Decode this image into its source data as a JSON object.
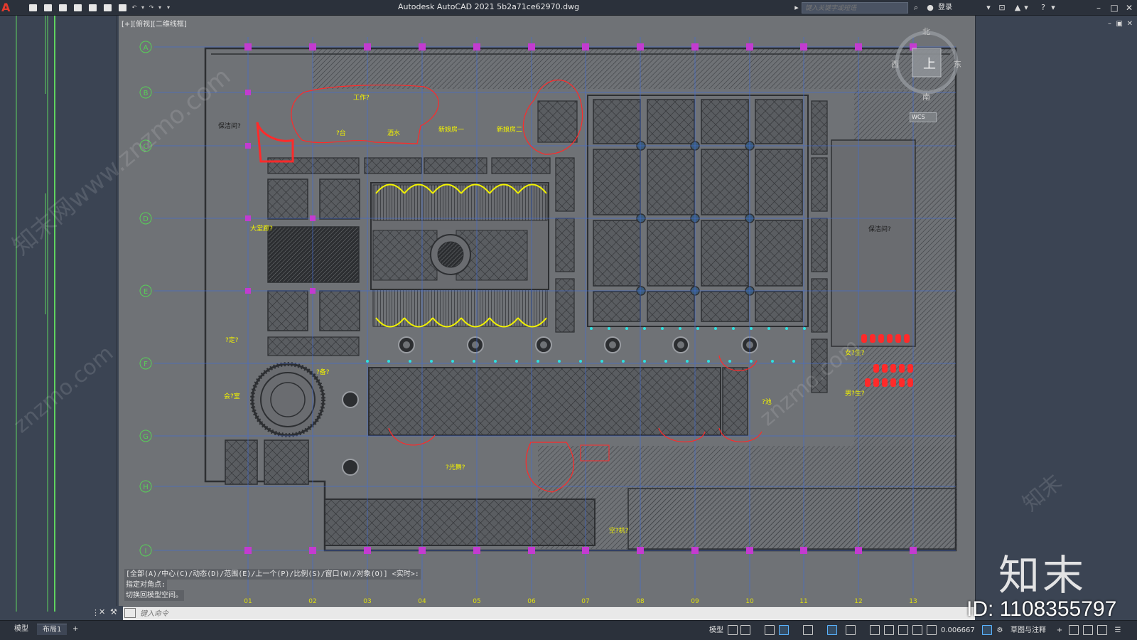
{
  "title_bar": {
    "app_title": "Autodesk AutoCAD 2021    5b2a71ce62970.dwg",
    "search_placeholder": "键入关键字或短语",
    "login_label": "登录",
    "logo_letter": "A"
  },
  "viewport": {
    "view_label": "[+][俯视][二维线框]"
  },
  "viewcube": {
    "north": "北",
    "south": "南",
    "east": "东",
    "west": "西",
    "top": "上",
    "wcs": "WCS"
  },
  "plan": {
    "row_axes": [
      "A",
      "B",
      "C",
      "D",
      "E",
      "F",
      "G",
      "H",
      "I"
    ],
    "col_axes": [
      "01",
      "02",
      "03",
      "04",
      "05",
      "06",
      "07",
      "08",
      "09",
      "10",
      "11",
      "12",
      "13"
    ],
    "room_labels": [
      {
        "text": "保洁间?",
        "key": "cleaning-room-left"
      },
      {
        "text": "工作?",
        "key": "work-room"
      },
      {
        "text": "?台",
        "key": "counter"
      },
      {
        "text": "酒水",
        "key": "drinks"
      },
      {
        "text": "新娘房一",
        "key": "bridal-room-1"
      },
      {
        "text": "新娘房二",
        "key": "bridal-room-2"
      },
      {
        "text": "大堂廊?",
        "key": "lobby-corridor"
      },
      {
        "text": "?定?",
        "key": "room-f1"
      },
      {
        "text": "会?室",
        "key": "meeting-room"
      },
      {
        "text": "?备?",
        "key": "equip-room"
      },
      {
        "text": "?光舞?",
        "key": "dance-floor"
      },
      {
        "text": "空?机?",
        "key": "ac-room"
      },
      {
        "text": "保洁间?",
        "key": "cleaning-room-right"
      },
      {
        "text": "女?生?",
        "key": "womens-restroom"
      },
      {
        "text": "男?生?",
        "key": "mens-restroom"
      },
      {
        "text": "?池",
        "key": "pool"
      }
    ]
  },
  "command": {
    "history": [
      "[全部(A)/中心(C)/动态(D)/范围(E)/上一个(P)/比例(S)/窗口(W)/对象(O)] <实时>:",
      "指定对角点:",
      "切换回模型空间。"
    ],
    "placeholder": "键入命令"
  },
  "status_bar": {
    "tabs": [
      "模型",
      "布局1"
    ],
    "add_tab": "+",
    "model_label": "模型",
    "scale_value": "0.006667",
    "workspace": "草图与注释"
  },
  "watermark": {
    "logo": "知末",
    "id": "ID: 1108355797",
    "site_text": "znzmo.com",
    "site_cn": "知末网www.znzmo.com"
  },
  "colors": {
    "canvas": "#6f7276",
    "hatch": "#3c3e42",
    "grid_axis": "#3f6bd8",
    "axis_bubble": "#57d157",
    "column": "#c33bd0",
    "label_yellow": "#f2f200",
    "red_line": "#ff2a2a",
    "cyan": "#2ee0e0"
  }
}
